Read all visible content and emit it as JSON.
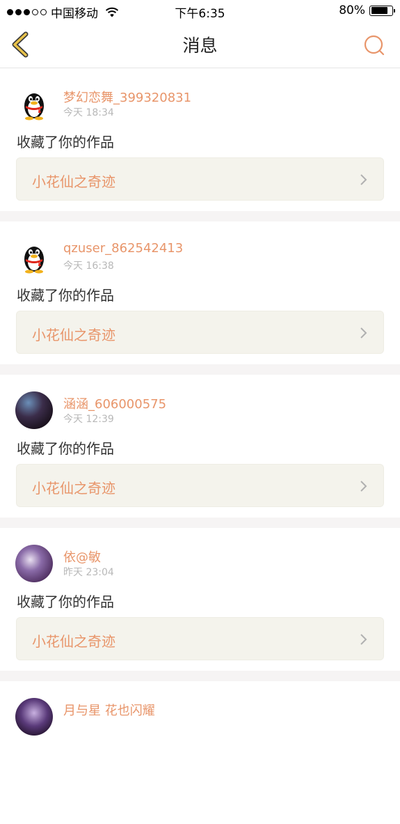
{
  "status_bar": {
    "carrier": "中国移动",
    "time": "下午6:35",
    "battery_text": "80%",
    "battery_level": 0.8,
    "signal_bars": 3,
    "signal_total": 5
  },
  "nav": {
    "title": "消息",
    "back_icon": "chevron-left-icon",
    "search_icon": "search-icon"
  },
  "colors": {
    "accent": "#e8956a",
    "back": "#d9a93a",
    "box_bg": "#f4f3ec"
  },
  "messages": [
    {
      "username": "梦幻恋舞_399320831",
      "time": "今天 18:34",
      "action": "收藏了你的作品",
      "work_title": "小花仙之奇迹",
      "avatar": "qq-penguin"
    },
    {
      "username": "qzuser_862542413",
      "time": "今天 16:38",
      "action": "收藏了你的作品",
      "work_title": "小花仙之奇迹",
      "avatar": "qq-penguin"
    },
    {
      "username": "涵涵_606000575",
      "time": "今天 12:39",
      "action": "收藏了你的作品",
      "work_title": "小花仙之奇迹",
      "avatar": "photo"
    },
    {
      "username": "依@敏",
      "time": "昨天 23:04",
      "action": "收藏了你的作品",
      "work_title": "小花仙之奇迹",
      "avatar": "photo"
    },
    {
      "username": "月与星 花也闪耀",
      "avatar": "photo"
    }
  ]
}
